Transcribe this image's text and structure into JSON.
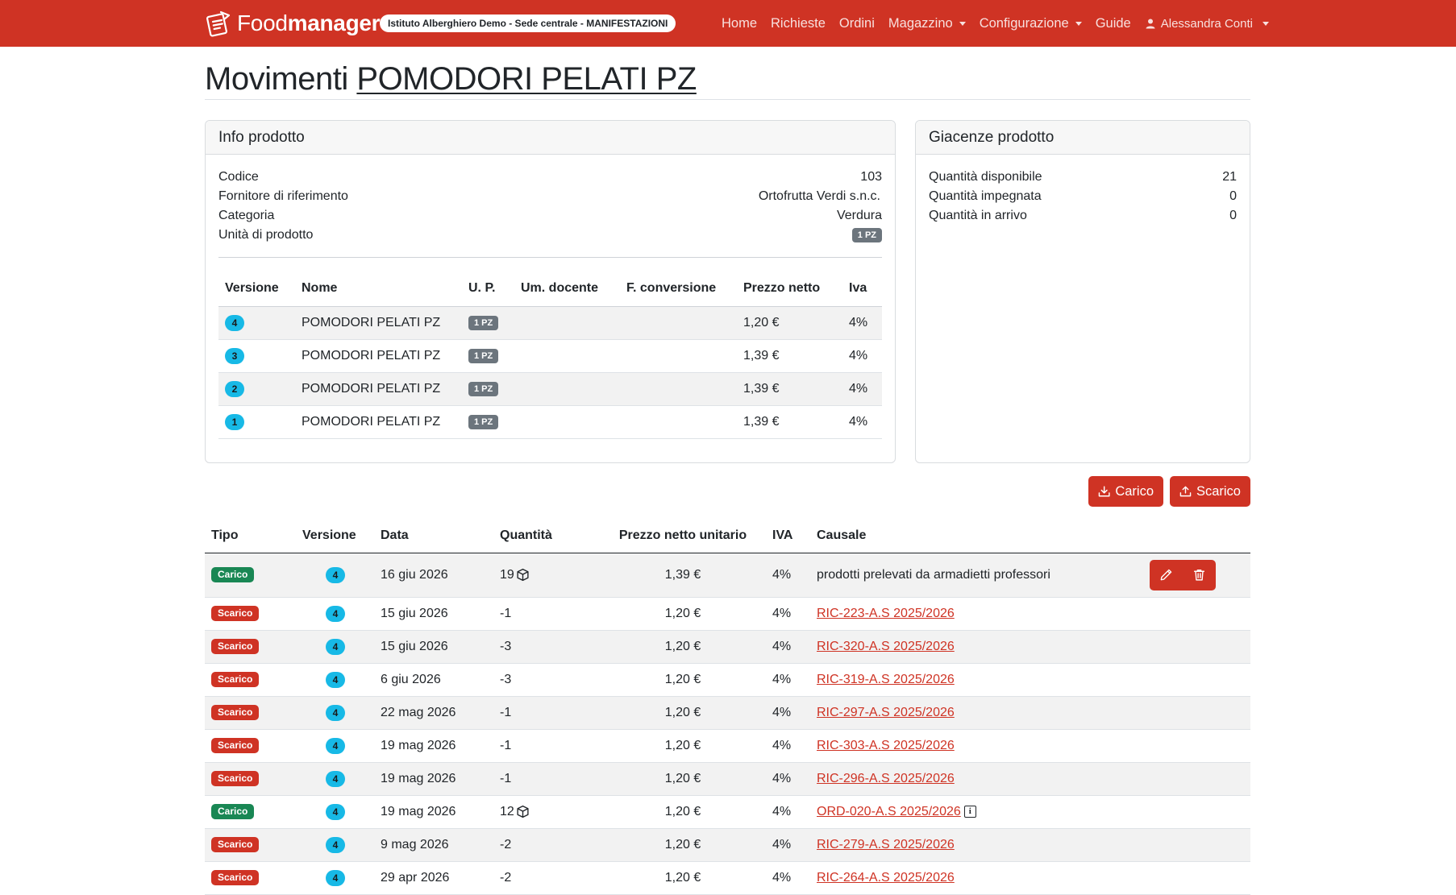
{
  "navbar": {
    "brand_light": "Food",
    "brand_bold": "manager",
    "org": "Istituto Alberghiero Demo - Sede centrale - MANIFESTAZIONI",
    "links": [
      "Home",
      "Richieste",
      "Ordini",
      "Magazzino",
      "Configurazione",
      "Guide"
    ],
    "user": "Alessandra Conti"
  },
  "page": {
    "title_prefix": "Movimenti",
    "title_product": "POMODORI PELATI PZ"
  },
  "info_card": {
    "header": "Info prodotto",
    "rows": [
      {
        "label": "Codice",
        "value": "103"
      },
      {
        "label": "Fornitore di riferimento",
        "value": "Ortofrutta Verdi s.n.c."
      },
      {
        "label": "Categoria",
        "value": "Verdura"
      },
      {
        "label": "Unità di prodotto",
        "value": "1 PZ"
      }
    ],
    "version_table": {
      "headers": [
        "Versione",
        "Nome",
        "U. P.",
        "Um. docente",
        "F. conversione",
        "Prezzo netto",
        "Iva"
      ],
      "rows": [
        {
          "version": "4",
          "name": "POMODORI PELATI PZ",
          "up": "1 PZ",
          "um": "",
          "fconv": "",
          "price": "1,20 €",
          "iva": "4%"
        },
        {
          "version": "3",
          "name": "POMODORI PELATI PZ",
          "up": "1 PZ",
          "um": "",
          "fconv": "",
          "price": "1,39 €",
          "iva": "4%"
        },
        {
          "version": "2",
          "name": "POMODORI PELATI PZ",
          "up": "1 PZ",
          "um": "",
          "fconv": "",
          "price": "1,39 €",
          "iva": "4%"
        },
        {
          "version": "1",
          "name": "POMODORI PELATI PZ",
          "up": "1 PZ",
          "um": "",
          "fconv": "",
          "price": "1,39 €",
          "iva": "4%"
        }
      ]
    }
  },
  "stock_card": {
    "header": "Giacenze prodotto",
    "rows": [
      {
        "label": "Quantità disponibile",
        "value": "21"
      },
      {
        "label": "Quantità impegnata",
        "value": "0"
      },
      {
        "label": "Quantità in arrivo",
        "value": "0"
      }
    ]
  },
  "buttons": {
    "carico": "Carico",
    "scarico": "Scarico"
  },
  "movements": {
    "headers": [
      "Tipo",
      "Versione",
      "Data",
      "Quantità",
      "Prezzo netto unitario",
      "IVA",
      "Causale"
    ],
    "rows": [
      {
        "tipo": "Carico",
        "version": "4",
        "date": "16 giu 2026",
        "qty": "19",
        "box": true,
        "price": "1,39 €",
        "iva": "4%",
        "causale": "prodotti prelevati da armadietti professori",
        "link": false,
        "info": false,
        "actions": true
      },
      {
        "tipo": "Scarico",
        "version": "4",
        "date": "15 giu 2026",
        "qty": "-1",
        "box": false,
        "price": "1,20 €",
        "iva": "4%",
        "causale": "RIC-223-A.S 2025/2026",
        "link": true,
        "info": false,
        "actions": false
      },
      {
        "tipo": "Scarico",
        "version": "4",
        "date": "15 giu 2026",
        "qty": "-3",
        "box": false,
        "price": "1,20 €",
        "iva": "4%",
        "causale": "RIC-320-A.S 2025/2026",
        "link": true,
        "info": false,
        "actions": false
      },
      {
        "tipo": "Scarico",
        "version": "4",
        "date": "6 giu 2026",
        "qty": "-3",
        "box": false,
        "price": "1,20 €",
        "iva": "4%",
        "causale": "RIC-319-A.S 2025/2026",
        "link": true,
        "info": false,
        "actions": false
      },
      {
        "tipo": "Scarico",
        "version": "4",
        "date": "22 mag 2026",
        "qty": "-1",
        "box": false,
        "price": "1,20 €",
        "iva": "4%",
        "causale": "RIC-297-A.S 2025/2026",
        "link": true,
        "info": false,
        "actions": false
      },
      {
        "tipo": "Scarico",
        "version": "4",
        "date": "19 mag 2026",
        "qty": "-1",
        "box": false,
        "price": "1,20 €",
        "iva": "4%",
        "causale": "RIC-303-A.S 2025/2026",
        "link": true,
        "info": false,
        "actions": false
      },
      {
        "tipo": "Scarico",
        "version": "4",
        "date": "19 mag 2026",
        "qty": "-1",
        "box": false,
        "price": "1,20 €",
        "iva": "4%",
        "causale": "RIC-296-A.S 2025/2026",
        "link": true,
        "info": false,
        "actions": false
      },
      {
        "tipo": "Carico",
        "version": "4",
        "date": "19 mag 2026",
        "qty": "12",
        "box": true,
        "price": "1,20 €",
        "iva": "4%",
        "causale": "ORD-020-A.S 2025/2026",
        "link": true,
        "info": true,
        "actions": false
      },
      {
        "tipo": "Scarico",
        "version": "4",
        "date": "9 mag 2026",
        "qty": "-2",
        "box": false,
        "price": "1,20 €",
        "iva": "4%",
        "causale": "RIC-279-A.S 2025/2026",
        "link": true,
        "info": false,
        "actions": false
      },
      {
        "tipo": "Scarico",
        "version": "4",
        "date": "29 apr 2026",
        "qty": "-2",
        "box": false,
        "price": "1,20 €",
        "iva": "4%",
        "causale": "RIC-264-A.S 2025/2026",
        "link": true,
        "info": false,
        "actions": false
      }
    ]
  },
  "colors": {
    "primary": "#cf3324",
    "success": "#198754",
    "info_badge": "#17b9e6",
    "secondary_badge": "#6c757d"
  },
  "icons": {
    "brand": "notepad-logo-icon",
    "user": "user-icon",
    "carico": "download-icon",
    "scarico": "upload-icon",
    "edit": "pencil-icon",
    "delete": "trash-icon",
    "quantity_box": "box-icon",
    "order_info": "info-icon"
  }
}
